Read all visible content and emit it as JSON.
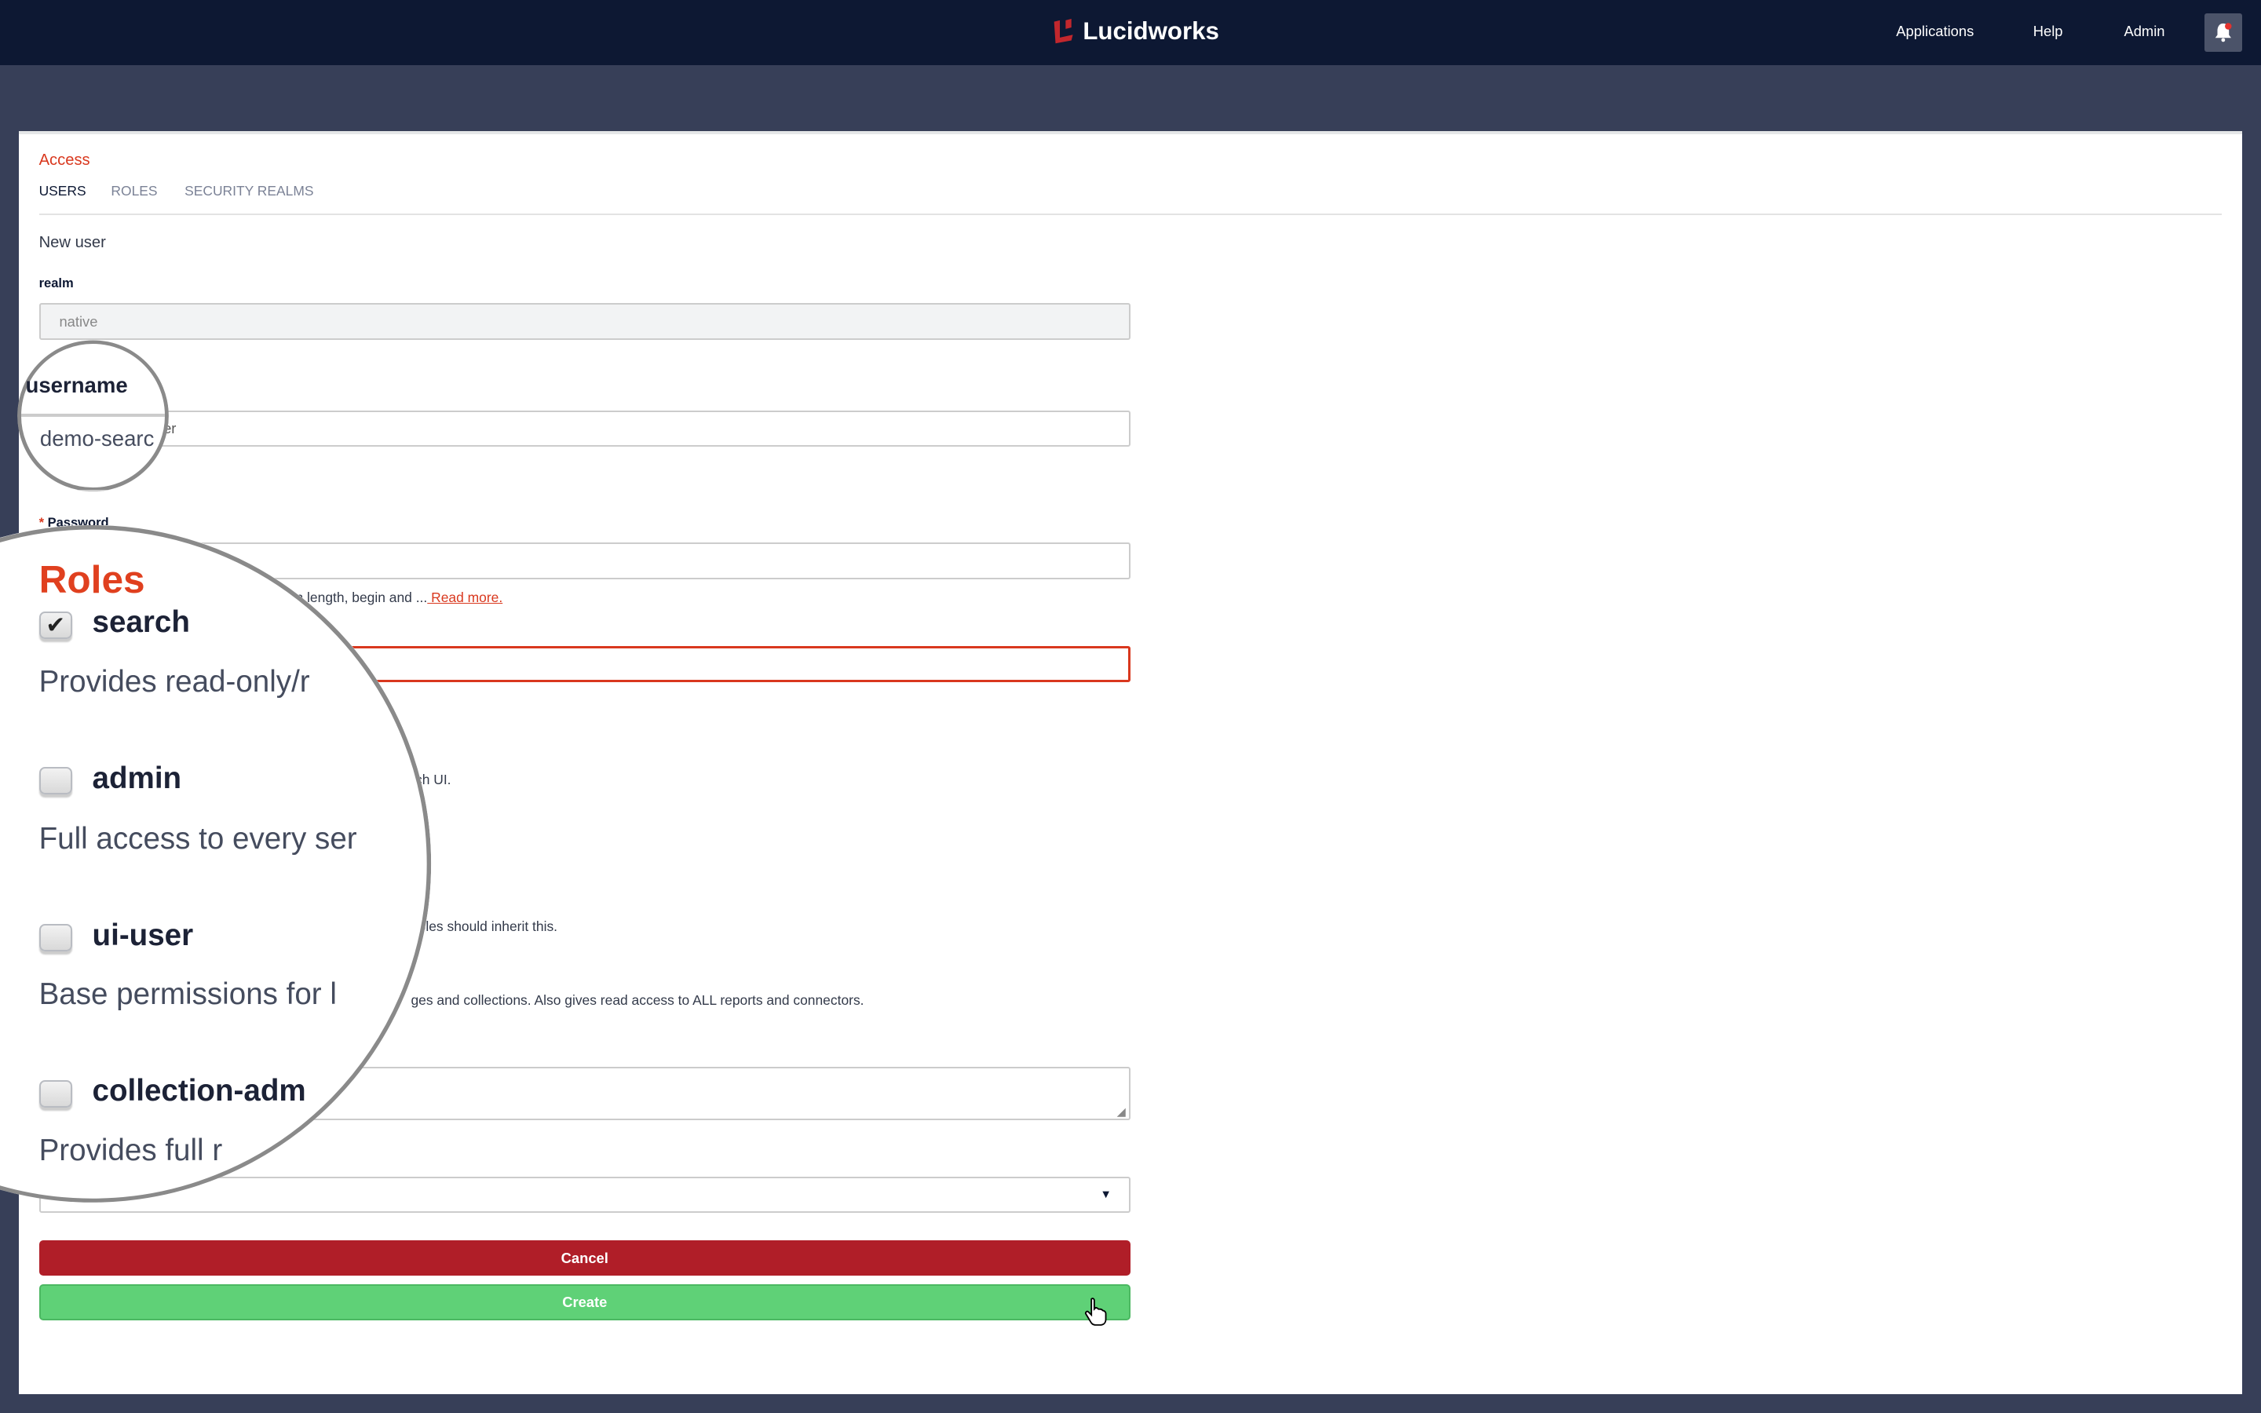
{
  "navbar": {
    "brand": "Lucidworks",
    "links": [
      "Applications",
      "Help",
      "Admin"
    ],
    "bell_icon": "bell-icon",
    "colors": {
      "background": "#0d1833",
      "brand_mark": "#c2272d"
    }
  },
  "page": {
    "section_title": "Access",
    "tabs": [
      {
        "label": "USERS",
        "active": true
      },
      {
        "label": "ROLES",
        "active": false
      },
      {
        "label": "SECURITY REALMS",
        "active": false
      }
    ],
    "form_title": "New user"
  },
  "form": {
    "realm_label": "realm",
    "realm_value": "native",
    "username_label": "username",
    "username_value": "demo-search-user",
    "username_visible_tail": "er",
    "password_label": "Password",
    "required_mark": "*",
    "password_help": "n length, begin and ...",
    "read_more": " Read more.",
    "role_desc_fragments": [
      "ch UI.",
      "oles should inherit this.",
      "ges and collections. Also gives read access to ALL reports and connectors."
    ],
    "cancel_label": "Cancel",
    "create_label": "Create"
  },
  "magnifier_username": {
    "label": "username",
    "value": "demo-searc"
  },
  "magnifier_roles": {
    "title": "Roles",
    "roles": [
      {
        "name": "search",
        "checked": true,
        "description": "Provides read-only/r"
      },
      {
        "name": "admin",
        "checked": false,
        "description": "Full access to every ser"
      },
      {
        "name": "ui-user",
        "checked": false,
        "description": "Base permissions for l"
      },
      {
        "name": "collection-adm",
        "checked": false,
        "description": "Provides full r"
      }
    ]
  },
  "colors": {
    "accent": "#d9381e",
    "cancel": "#b01e28",
    "create": "#5fd177"
  }
}
